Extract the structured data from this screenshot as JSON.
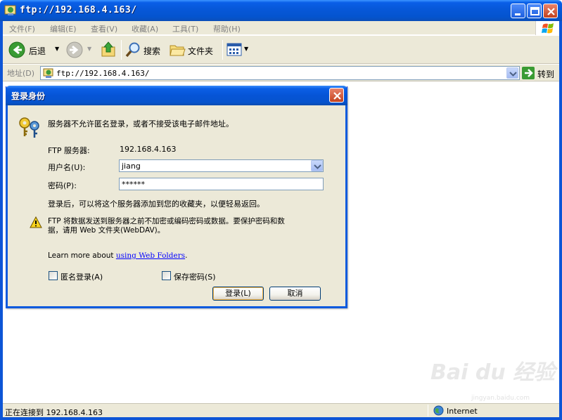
{
  "window": {
    "title": "ftp://192.168.4.163/",
    "menu": [
      "文件(F)",
      "编辑(E)",
      "查看(V)",
      "收藏(A)",
      "工具(T)",
      "帮助(H)"
    ]
  },
  "toolbar": {
    "back_label": "后退",
    "search_label": "搜索",
    "folders_label": "文件夹"
  },
  "address": {
    "label": "地址(D)",
    "value": "ftp://192.168.4.163/",
    "go_label": "转到"
  },
  "status": {
    "text": "正在连接到 192.168.4.163",
    "zone": "Internet"
  },
  "dialog": {
    "title": "登录身份",
    "message": "服务器不允许匿名登录，或者不接受该电子邮件地址。",
    "server_label": "FTP 服务器:",
    "server_value": "192.168.4.163",
    "username_label": "用户名(U):",
    "username_value": "jiang",
    "password_label": "密码(P):",
    "password_value": "******",
    "after_login_note": "登录后，可以将这个服务器添加到您的收藏夹，以便轻易返回。",
    "warning_line1": "FTP 将数据发送到服务器之前不加密或编码密码或数据。要保护密码和数",
    "warning_line2": "据，请用 Web 文件夹(WebDAV)。",
    "learn_more_prefix": "Learn more about ",
    "learn_more_link": "using Web Folders",
    "learn_more_suffix": ".",
    "anonymous_label": "匿名登录(A)",
    "anonymous_checked": false,
    "save_password_label": "保存密码(S)",
    "save_password_checked": false,
    "login_button": "登录(L)",
    "cancel_button": "取消"
  },
  "watermark": {
    "brand": "Bai du 经验",
    "url": "jingyan.baidu.com"
  }
}
